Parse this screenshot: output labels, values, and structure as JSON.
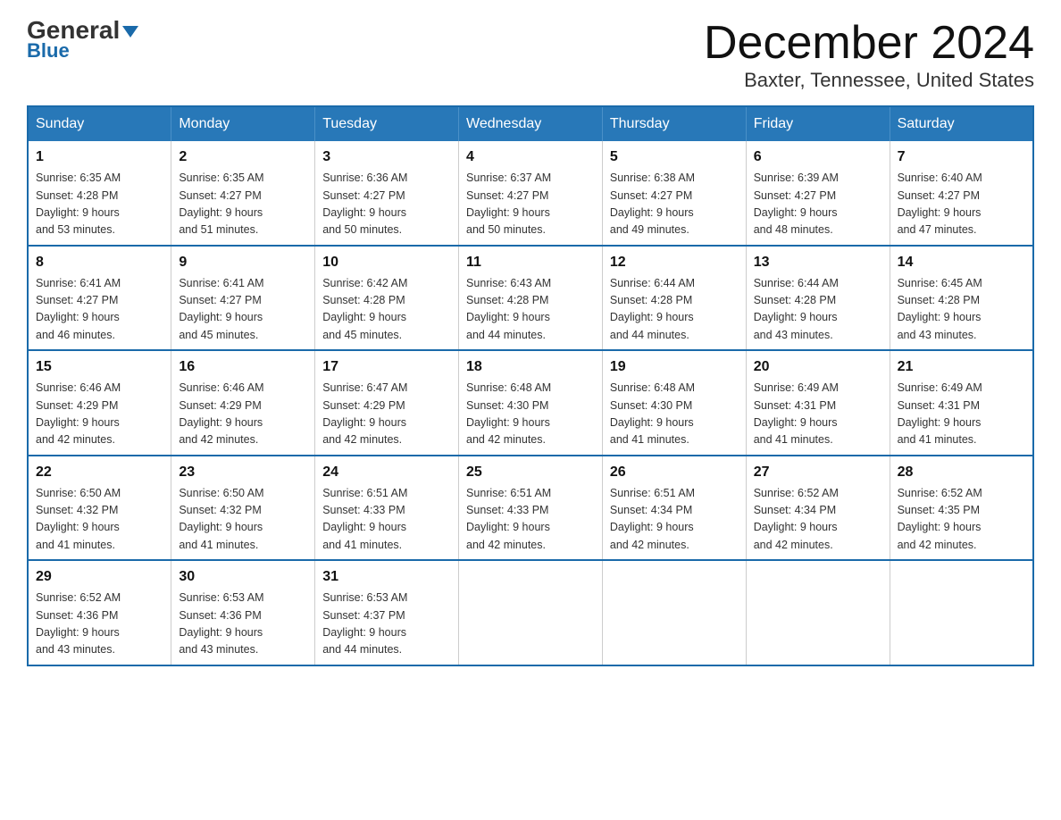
{
  "header": {
    "logo_line1": "General",
    "logo_line2": "Blue",
    "month_title": "December 2024",
    "location": "Baxter, Tennessee, United States"
  },
  "weekdays": [
    "Sunday",
    "Monday",
    "Tuesday",
    "Wednesday",
    "Thursday",
    "Friday",
    "Saturday"
  ],
  "weeks": [
    [
      {
        "day": "1",
        "sunrise": "6:35 AM",
        "sunset": "4:28 PM",
        "daylight": "9 hours and 53 minutes."
      },
      {
        "day": "2",
        "sunrise": "6:35 AM",
        "sunset": "4:27 PM",
        "daylight": "9 hours and 51 minutes."
      },
      {
        "day": "3",
        "sunrise": "6:36 AM",
        "sunset": "4:27 PM",
        "daylight": "9 hours and 50 minutes."
      },
      {
        "day": "4",
        "sunrise": "6:37 AM",
        "sunset": "4:27 PM",
        "daylight": "9 hours and 50 minutes."
      },
      {
        "day": "5",
        "sunrise": "6:38 AM",
        "sunset": "4:27 PM",
        "daylight": "9 hours and 49 minutes."
      },
      {
        "day": "6",
        "sunrise": "6:39 AM",
        "sunset": "4:27 PM",
        "daylight": "9 hours and 48 minutes."
      },
      {
        "day": "7",
        "sunrise": "6:40 AM",
        "sunset": "4:27 PM",
        "daylight": "9 hours and 47 minutes."
      }
    ],
    [
      {
        "day": "8",
        "sunrise": "6:41 AM",
        "sunset": "4:27 PM",
        "daylight": "9 hours and 46 minutes."
      },
      {
        "day": "9",
        "sunrise": "6:41 AM",
        "sunset": "4:27 PM",
        "daylight": "9 hours and 45 minutes."
      },
      {
        "day": "10",
        "sunrise": "6:42 AM",
        "sunset": "4:28 PM",
        "daylight": "9 hours and 45 minutes."
      },
      {
        "day": "11",
        "sunrise": "6:43 AM",
        "sunset": "4:28 PM",
        "daylight": "9 hours and 44 minutes."
      },
      {
        "day": "12",
        "sunrise": "6:44 AM",
        "sunset": "4:28 PM",
        "daylight": "9 hours and 44 minutes."
      },
      {
        "day": "13",
        "sunrise": "6:44 AM",
        "sunset": "4:28 PM",
        "daylight": "9 hours and 43 minutes."
      },
      {
        "day": "14",
        "sunrise": "6:45 AM",
        "sunset": "4:28 PM",
        "daylight": "9 hours and 43 minutes."
      }
    ],
    [
      {
        "day": "15",
        "sunrise": "6:46 AM",
        "sunset": "4:29 PM",
        "daylight": "9 hours and 42 minutes."
      },
      {
        "day": "16",
        "sunrise": "6:46 AM",
        "sunset": "4:29 PM",
        "daylight": "9 hours and 42 minutes."
      },
      {
        "day": "17",
        "sunrise": "6:47 AM",
        "sunset": "4:29 PM",
        "daylight": "9 hours and 42 minutes."
      },
      {
        "day": "18",
        "sunrise": "6:48 AM",
        "sunset": "4:30 PM",
        "daylight": "9 hours and 42 minutes."
      },
      {
        "day": "19",
        "sunrise": "6:48 AM",
        "sunset": "4:30 PM",
        "daylight": "9 hours and 41 minutes."
      },
      {
        "day": "20",
        "sunrise": "6:49 AM",
        "sunset": "4:31 PM",
        "daylight": "9 hours and 41 minutes."
      },
      {
        "day": "21",
        "sunrise": "6:49 AM",
        "sunset": "4:31 PM",
        "daylight": "9 hours and 41 minutes."
      }
    ],
    [
      {
        "day": "22",
        "sunrise": "6:50 AM",
        "sunset": "4:32 PM",
        "daylight": "9 hours and 41 minutes."
      },
      {
        "day": "23",
        "sunrise": "6:50 AM",
        "sunset": "4:32 PM",
        "daylight": "9 hours and 41 minutes."
      },
      {
        "day": "24",
        "sunrise": "6:51 AM",
        "sunset": "4:33 PM",
        "daylight": "9 hours and 41 minutes."
      },
      {
        "day": "25",
        "sunrise": "6:51 AM",
        "sunset": "4:33 PM",
        "daylight": "9 hours and 42 minutes."
      },
      {
        "day": "26",
        "sunrise": "6:51 AM",
        "sunset": "4:34 PM",
        "daylight": "9 hours and 42 minutes."
      },
      {
        "day": "27",
        "sunrise": "6:52 AM",
        "sunset": "4:34 PM",
        "daylight": "9 hours and 42 minutes."
      },
      {
        "day": "28",
        "sunrise": "6:52 AM",
        "sunset": "4:35 PM",
        "daylight": "9 hours and 42 minutes."
      }
    ],
    [
      {
        "day": "29",
        "sunrise": "6:52 AM",
        "sunset": "4:36 PM",
        "daylight": "9 hours and 43 minutes."
      },
      {
        "day": "30",
        "sunrise": "6:53 AM",
        "sunset": "4:36 PM",
        "daylight": "9 hours and 43 minutes."
      },
      {
        "day": "31",
        "sunrise": "6:53 AM",
        "sunset": "4:37 PM",
        "daylight": "9 hours and 44 minutes."
      },
      null,
      null,
      null,
      null
    ]
  ],
  "labels": {
    "sunrise": "Sunrise:",
    "sunset": "Sunset:",
    "daylight": "Daylight:"
  }
}
